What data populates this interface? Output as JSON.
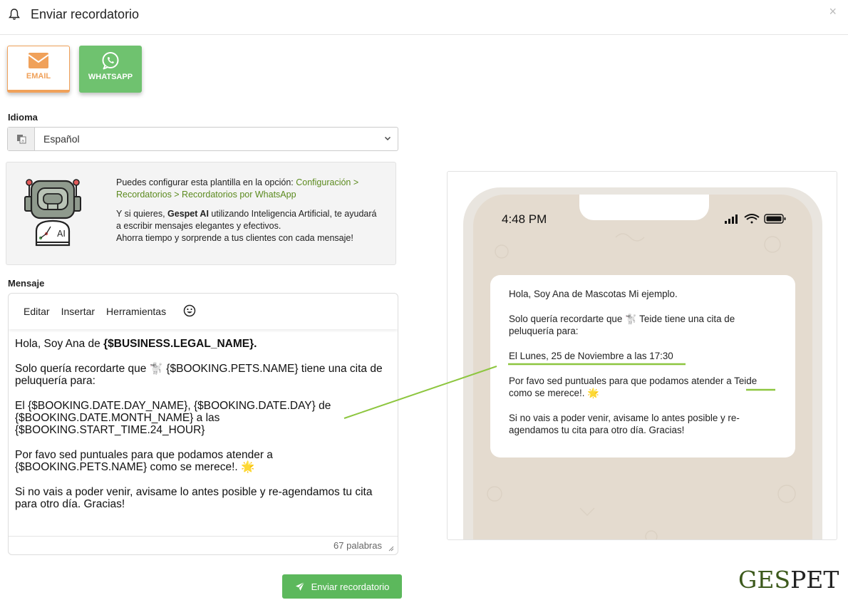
{
  "header": {
    "title": "Enviar recordatorio",
    "close_glyph": "×"
  },
  "channels": {
    "email_label": "EMAIL",
    "whatsapp_label": "WHATSAPP",
    "email_color": "#f0a15a",
    "whatsapp_color": "#6fc26f",
    "selected": "EMAIL"
  },
  "language": {
    "label": "Idioma",
    "value": "Español"
  },
  "info": {
    "line1_prefix": "Puedes configurar esta plantilla en la opción: ",
    "line1_link": "Configuración > Recordatorios > Recordatorios por WhatsApp",
    "p2_prefix": "Y si quieres, ",
    "p2_brand": "Gespet AI",
    "p2_rest": " utilizando Inteligencia Artificial, te ayudará a escribir mensajes elegantes y efectivos.",
    "p2_line3": "Ahorra tiempo y sorprende a tus clientes con cada mensaje!",
    "robot_badge": "AI",
    "link_color": "#5b8a1e"
  },
  "editor": {
    "label": "Mensaje",
    "menu": [
      "Editar",
      "Insertar",
      "Herramientas"
    ],
    "emoji_glyph": "☺",
    "greeting_prefix": "Hola, Soy Ana de ",
    "greeting_var": "{$BUSINESS.LEGAL_NAME}.",
    "p2": "Solo quería recordarte que 🐩 {$BOOKING.PETS.NAME} tiene una cita de peluquería para:",
    "p3_line1": "El {$BOOKING.DATE.DAY_NAME}, {$BOOKING.DATE.DAY} de",
    "p3_line2": "{$BOOKING.DATE.MONTH_NAME} a las",
    "p3_line3": "{$BOOKING.START_TIME.24_HOUR}",
    "p4_line1": "Por favo sed puntuales para que podamos atender a",
    "p4_line2": "{$BOOKING.PETS.NAME} como se merece!. 🌟",
    "p5": "Si no vais a poder venir, avisame lo antes posible y re-agendamos tu cita para otro día. Gracias!",
    "word_count": "67 palabras"
  },
  "submit": {
    "label": "Enviar recordatorio",
    "color": "#5cb85c"
  },
  "preview": {
    "time": "4:48 PM",
    "p1": "Hola, Soy Ana de Mascotas Mi ejemplo.",
    "p2": "Solo quería recordarte que 🐩 Teide tiene una cita de peluquería para:",
    "p3": "El Lunes, 25 de Noviembre a las 17:30",
    "p4_prefix": "Por favo sed puntuales para que podamos atender a ",
    "p4_pet": "Teide",
    "p4_suffix": " como se merece!. 🌟",
    "p5": "Si no vais a poder venir, avisame lo antes posible y re-agendamos tu cita para otro día. Gracias!",
    "highlight_color": "#8dc63f"
  },
  "logo": {
    "part1": "GES",
    "part2": "PET"
  }
}
